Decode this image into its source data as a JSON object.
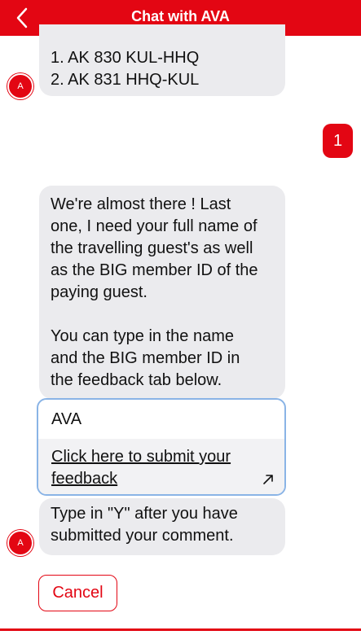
{
  "header": {
    "title": "Chat with AVA",
    "back_icon": "chevron-left-icon",
    "background_color": "#e30613"
  },
  "messages": {
    "flight_list": [
      "1. AK 830 KUL-HHQ",
      "2. AK 831 HHQ-KUL"
    ],
    "user_reply": "1",
    "request_lines": [
      "We're almost there !  Last",
      "one, I need your full name of",
      "the travelling guest's as well",
      "as the BIG member ID of the",
      "paying guest."
    ],
    "instruction_lines": [
      "You can type in the name",
      "and the BIG member ID in",
      "the feedback tab below."
    ],
    "confirm_lines": [
      "Type in \"Y\"  after you have",
      "submitted your comment."
    ]
  },
  "bot_avatar": {
    "label": "A",
    "color": "#e30613"
  },
  "feedback_card": {
    "title": "AVA",
    "link_lines": [
      "Click here to submit your",
      "feedback"
    ],
    "link_icon": "external-link-icon",
    "border_color": "#8ab4e6"
  },
  "actions": {
    "cancel_label": "Cancel"
  }
}
